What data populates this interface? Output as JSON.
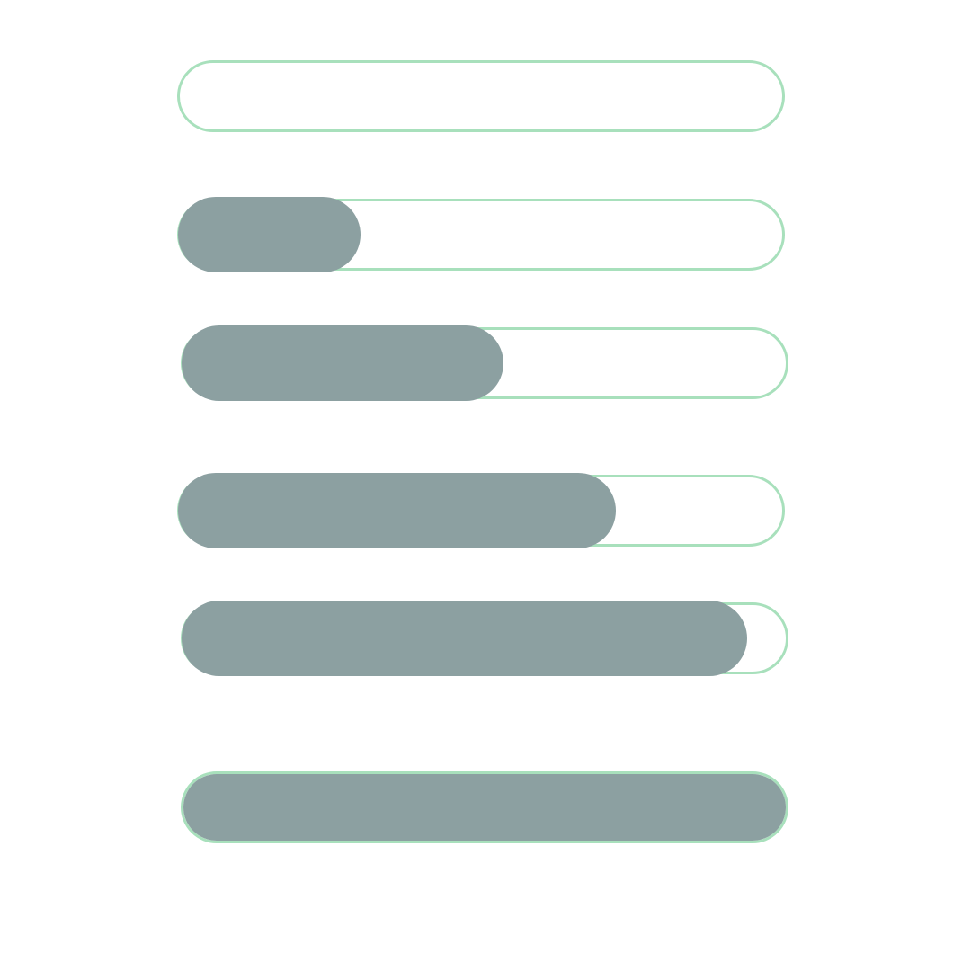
{
  "colors": {
    "track_border": "#a8e0bc",
    "fill": "#8ca0a1",
    "background": "#ffffff"
  },
  "progress_bars": [
    {
      "fill_fraction": 0.0
    },
    {
      "fill_fraction": 0.3
    },
    {
      "fill_fraction": 0.53
    },
    {
      "fill_fraction": 0.72
    },
    {
      "fill_fraction": 0.93
    },
    {
      "fill_fraction": 1.0
    }
  ]
}
